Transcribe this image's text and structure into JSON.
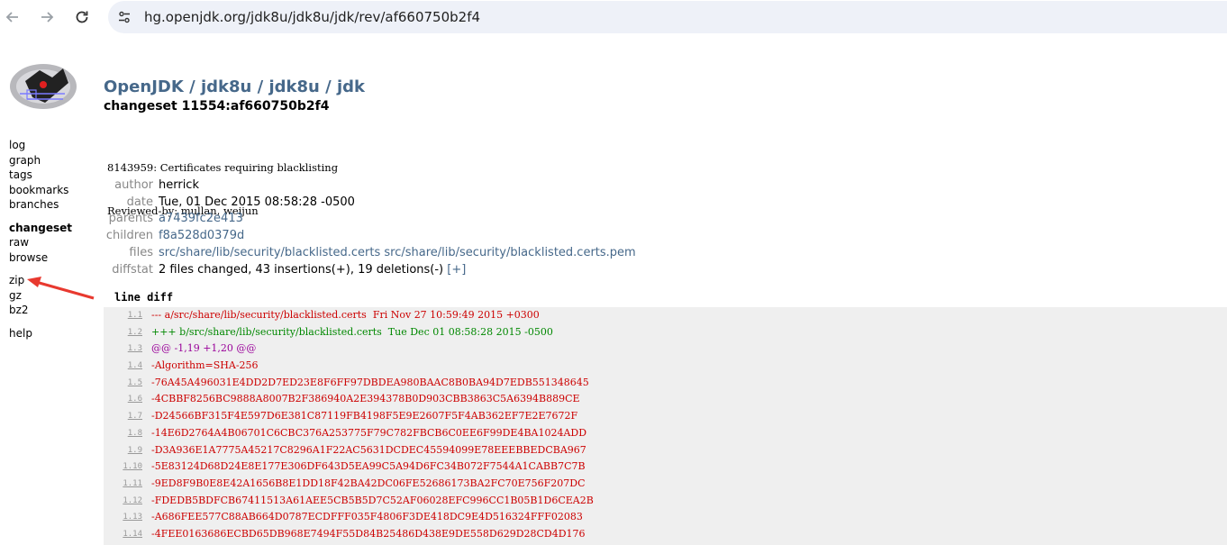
{
  "browser": {
    "url": "hg.openjdk.org/jdk8u/jdk8u/jdk/rev/af660750b2f4"
  },
  "colors": {
    "link": "#46688a",
    "removed": "#cc0000",
    "added": "#008800",
    "hunk": "#990099",
    "annotation_arrow": "#e8392f"
  },
  "sidebar": {
    "groups": [
      [
        "log",
        "graph",
        "tags",
        "bookmarks",
        "branches"
      ],
      [
        "changeset",
        "raw",
        "browse"
      ],
      [
        "zip",
        "gz",
        "bz2"
      ],
      [
        "help"
      ]
    ],
    "active": "changeset"
  },
  "breadcrumb": {
    "items": [
      "OpenJDK",
      "jdk8u",
      "jdk8u",
      "jdk"
    ],
    "separator": "/"
  },
  "changeset_title": "changeset 11554:af660750b2f4",
  "description": [
    "8143959: Certificates requiring blacklisting",
    "Reviewed-by: mullan, weijun"
  ],
  "meta": {
    "author": {
      "label": "author",
      "value": "herrick"
    },
    "date": {
      "label": "date",
      "value": "Tue, 01 Dec 2015 08:58:28 -0500"
    },
    "parents": {
      "label": "parents",
      "value": "a7439fc2e413"
    },
    "children": {
      "label": "children",
      "value": "f8a528d0379d"
    },
    "files": {
      "label": "files",
      "values": [
        "src/share/lib/security/blacklisted.certs",
        "src/share/lib/security/blacklisted.certs.pem"
      ]
    },
    "diffstat": {
      "label": "diffstat",
      "value": "2 files changed, 43 insertions(+), 19 deletions(-)",
      "toggle": "[+]"
    }
  },
  "diff_header": {
    "line": "line",
    "diff": "diff"
  },
  "diff_lines": [
    {
      "num": "1.1",
      "text": "--- a/src/share/lib/security/blacklisted.certs  Fri Nov 27 10:59:49 2015 +0300",
      "kind": "minus"
    },
    {
      "num": "1.2",
      "text": "+++ b/src/share/lib/security/blacklisted.certs  Tue Dec 01 08:58:28 2015 -0500",
      "kind": "plus"
    },
    {
      "num": "1.3",
      "text": "@@ -1,19 +1,20 @@",
      "kind": "atat"
    },
    {
      "num": "1.4",
      "text": "-Algorithm=SHA-256",
      "kind": "minus"
    },
    {
      "num": "1.5",
      "text": "-76A45A496031E4DD2D7ED23E8F6FF97DBDEA980BAAC8B0BA94D7EDB551348645",
      "kind": "minus"
    },
    {
      "num": "1.6",
      "text": "-4CBBF8256BC9888A8007B2F386940A2E394378B0D903CBB3863C5A6394B889CE",
      "kind": "minus"
    },
    {
      "num": "1.7",
      "text": "-D24566BF315F4E597D6E381C87119FB4198F5E9E2607F5F4AB362EF7E2E7672F",
      "kind": "minus"
    },
    {
      "num": "1.8",
      "text": "-14E6D2764A4B06701C6CBC376A253775F79C782FBCB6C0EE6F99DE4BA1024ADD",
      "kind": "minus"
    },
    {
      "num": "1.9",
      "text": "-D3A936E1A7775A45217C8296A1F22AC5631DCDEC45594099E78EEEBBEDCBA967",
      "kind": "minus"
    },
    {
      "num": "1.10",
      "text": "-5E83124D68D24E8E177E306DF643D5EA99C5A94D6FC34B072F7544A1CABB7C7B",
      "kind": "minus"
    },
    {
      "num": "1.11",
      "text": "-9ED8F9B0E8E42A1656B8E1DD18F42BA42DC06FE52686173BA2FC70E756F207DC",
      "kind": "minus"
    },
    {
      "num": "1.12",
      "text": "-FDEDB5BDFCB67411513A61AEE5CB5B5D7C52AF06028EFC996CC1B05B1D6CEA2B",
      "kind": "minus"
    },
    {
      "num": "1.13",
      "text": "-A686FEE577C88AB664D0787ECDFFF035F4806F3DE418DC9E4D516324FFF02083",
      "kind": "minus"
    },
    {
      "num": "1.14",
      "text": "-4FEE0163686ECBD65DB968E7494F55D84B25486D438E9DE558D629D28CD4D176",
      "kind": "minus"
    }
  ]
}
